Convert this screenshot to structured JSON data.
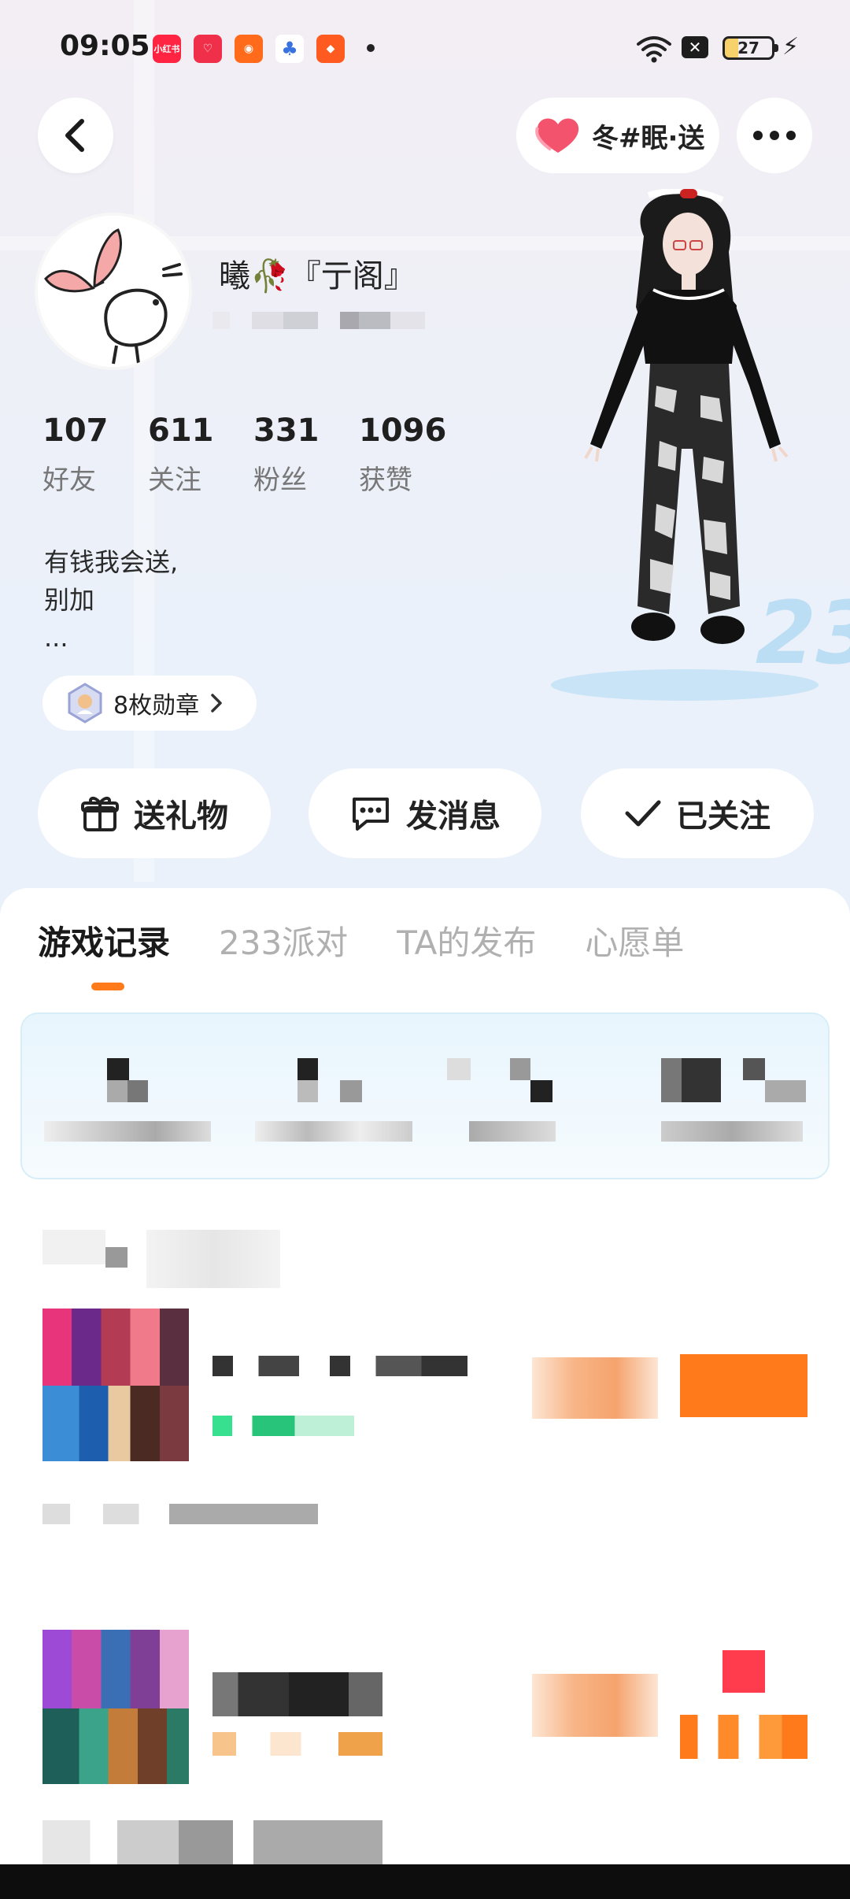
{
  "status_bar": {
    "time": "09:05",
    "battery": "27",
    "notification_icons": [
      {
        "label": "小红书",
        "color": "#ff2442"
      },
      {
        "label": "♡",
        "color": "#f0304a"
      },
      {
        "label": "◉",
        "color": "#ff6b1a"
      },
      {
        "label": "♣",
        "color": "#3872e0"
      },
      {
        "label": "◆",
        "color": "#ff5a1f"
      }
    ]
  },
  "header": {
    "pill_label": "冬#眠·送"
  },
  "profile": {
    "nickname": "曦🥀『亍阁』",
    "stats": [
      {
        "num": "107",
        "label": "好友"
      },
      {
        "num": "611",
        "label": "关注"
      },
      {
        "num": "331",
        "label": "粉丝"
      },
      {
        "num": "1096",
        "label": "获赞"
      }
    ],
    "bio": "有钱我会送,\n别加\n...",
    "badges_label": "8枚勋章"
  },
  "actions": {
    "gift": "送礼物",
    "message": "发消息",
    "following": "已关注"
  },
  "tabs": [
    "游戏记录",
    "233派对",
    "TA的发布",
    "心愿单"
  ],
  "colors": {
    "accent": "#ff7a1a",
    "heart": "#f4536d"
  }
}
